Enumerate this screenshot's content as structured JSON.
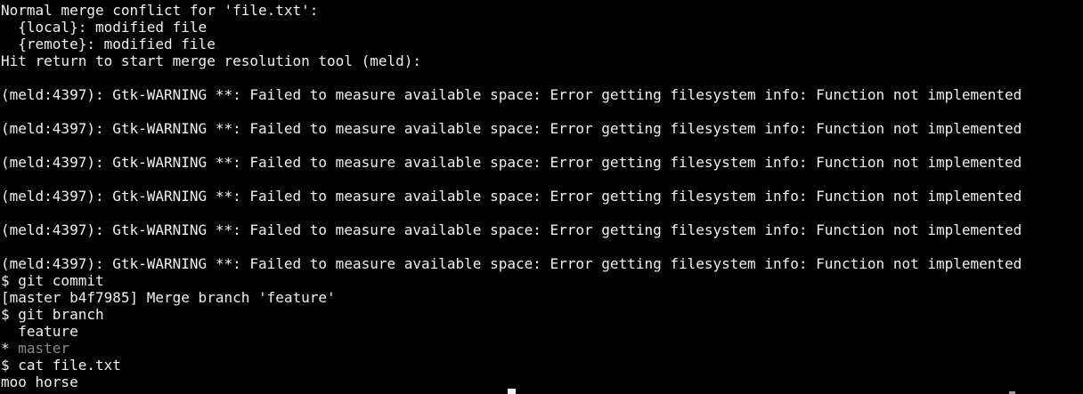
{
  "terminal": {
    "colors": {
      "background": "#000000",
      "foreground": "#f0f0f0",
      "dim": "#8a8a8a"
    },
    "lines": [
      "Normal merge conflict for 'file.txt':",
      "  {local}: modified file",
      "  {remote}: modified file",
      "Hit return to start merge resolution tool (meld):",
      "",
      "(meld:4397): Gtk-WARNING **: Failed to measure available space: Error getting filesystem info: Function not implemented",
      "",
      "(meld:4397): Gtk-WARNING **: Failed to measure available space: Error getting filesystem info: Function not implemented",
      "",
      "(meld:4397): Gtk-WARNING **: Failed to measure available space: Error getting filesystem info: Function not implemented",
      "",
      "(meld:4397): Gtk-WARNING **: Failed to measure available space: Error getting filesystem info: Function not implemented",
      "",
      "(meld:4397): Gtk-WARNING **: Failed to measure available space: Error getting filesystem info: Function not implemented",
      "",
      "(meld:4397): Gtk-WARNING **: Failed to measure available space: Error getting filesystem info: Function not implemented",
      "$ git commit",
      "[master b4f7985] Merge branch 'feature'",
      "$ git branch",
      "  feature",
      "* ",
      "$ cat file.txt",
      "moo horse"
    ],
    "current_branch": "master"
  }
}
